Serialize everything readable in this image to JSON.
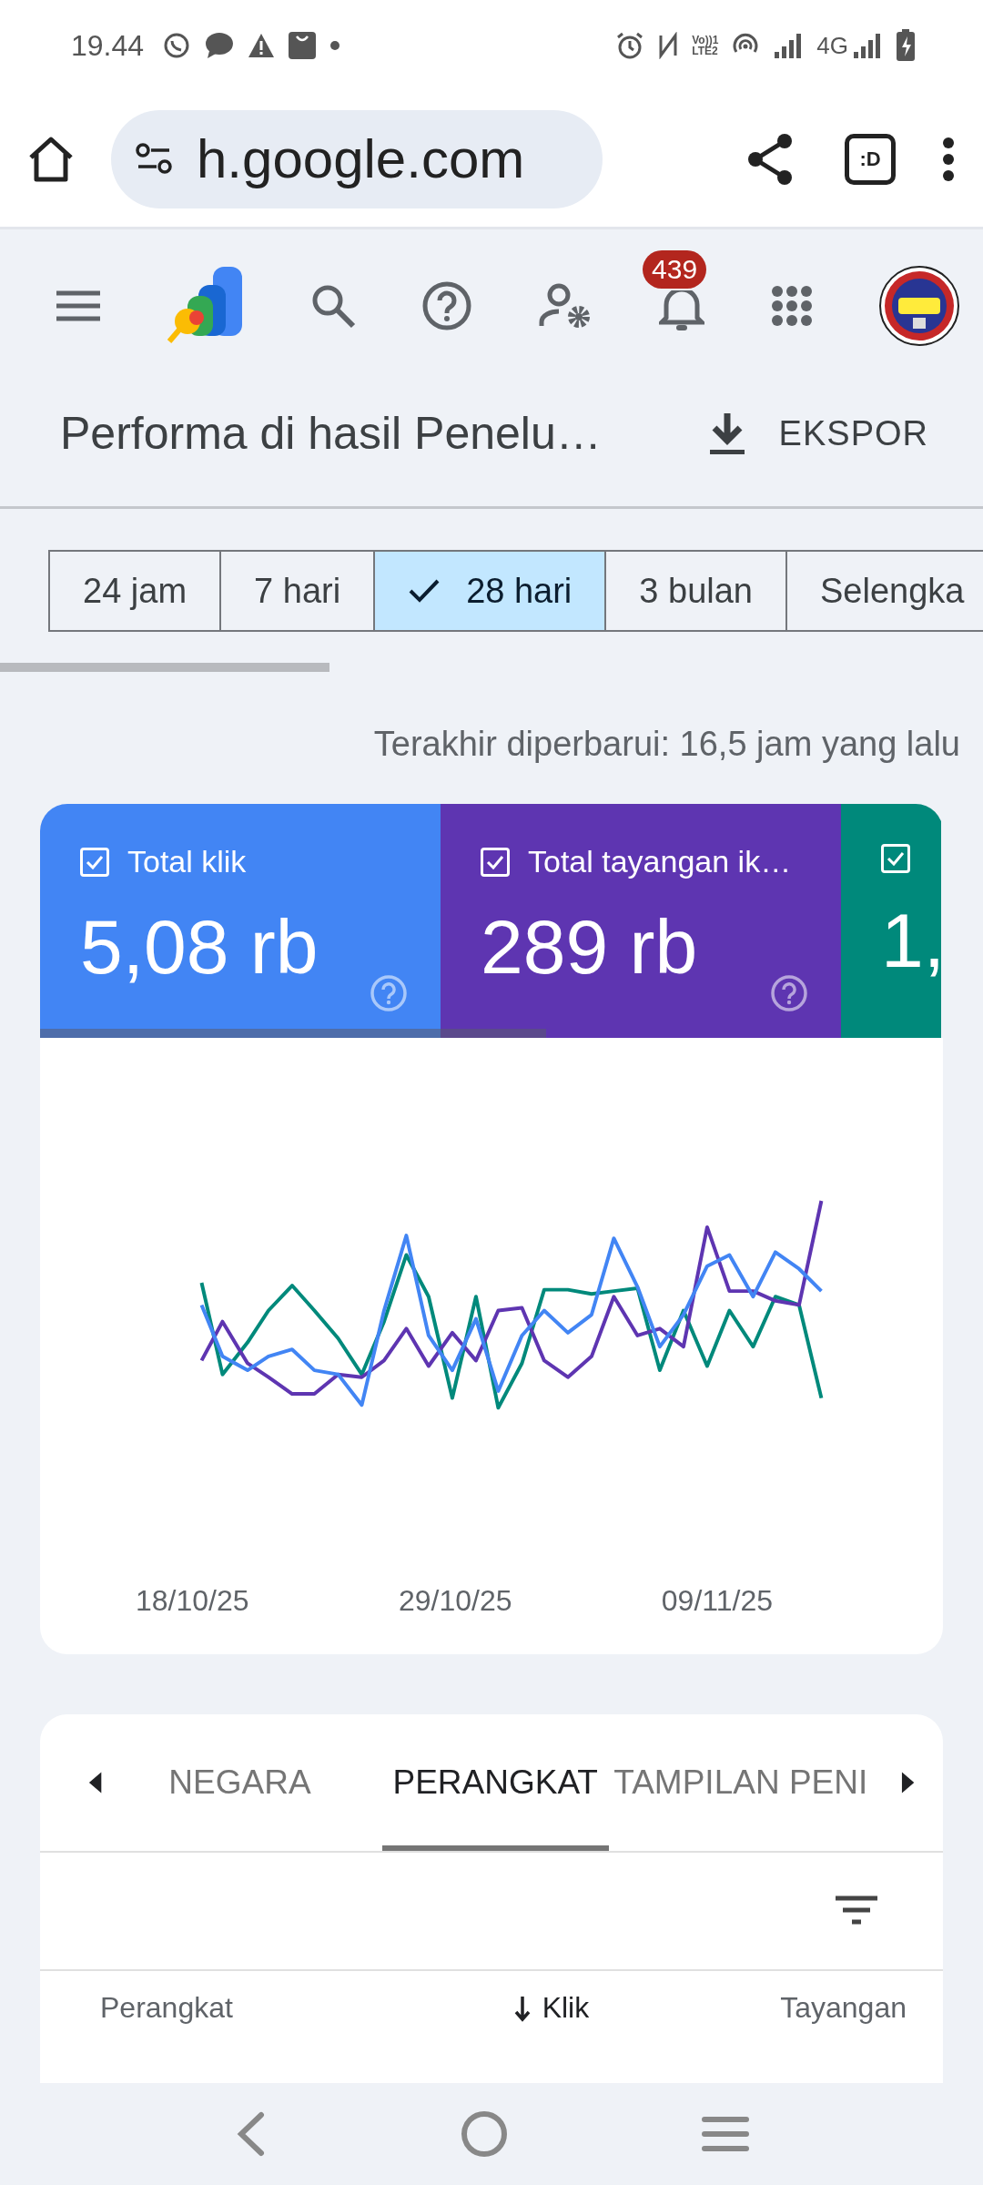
{
  "status_bar": {
    "time": "19.44",
    "volte_top": "Vo))1",
    "volte_bottom": "LTE2",
    "network": "4G"
  },
  "browser": {
    "url": "h.google.com",
    "tabs_label": ":D"
  },
  "app_bar": {
    "notification_count": "439"
  },
  "header": {
    "title": "Performa di hasil Penelu…",
    "export": "EKSPOR"
  },
  "ranges": [
    {
      "label": "24 jam",
      "selected": false
    },
    {
      "label": "7 hari",
      "selected": false
    },
    {
      "label": "28 hari",
      "selected": true
    },
    {
      "label": "3 bulan",
      "selected": false
    },
    {
      "label": "Selengka",
      "selected": false
    }
  ],
  "updated": "Terakhir diperbarui: 16,5 jam yang lalu",
  "metrics": [
    {
      "label": "Total klik",
      "value": "5,08 rb",
      "checked": true,
      "color": "#4285f4"
    },
    {
      "label": "Total tayangan ik…",
      "value": "289 rb",
      "checked": true,
      "color": "#5e35b1"
    },
    {
      "value": "1,",
      "checked": true,
      "color": "#00897b"
    }
  ],
  "chart_dates": [
    "18/10/25",
    "29/10/25",
    "09/11/25"
  ],
  "dimension_tabs": [
    {
      "label": "NEGARA",
      "selected": false
    },
    {
      "label": "PERANGKAT",
      "selected": true
    },
    {
      "label": "TAMPILAN PENI",
      "selected": false
    }
  ],
  "table": {
    "columns": [
      "Perangkat",
      "Klik",
      "Tayangan"
    ]
  }
}
